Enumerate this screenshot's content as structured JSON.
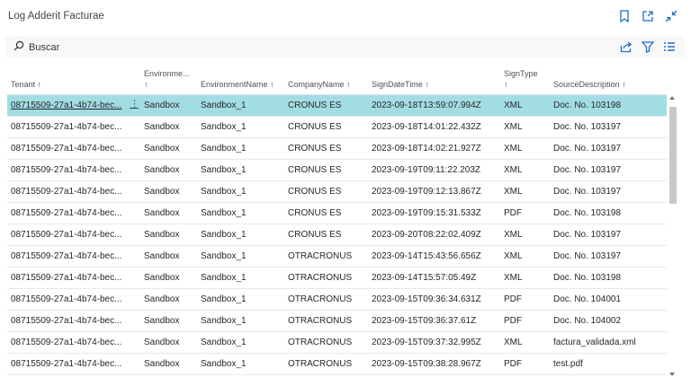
{
  "window": {
    "title": "Log Adderit Facturae",
    "icons": [
      "bookmark-icon",
      "open-new-window-icon",
      "collapse-icon"
    ]
  },
  "toolbar": {
    "search_label": "Buscar",
    "icons": [
      "share-icon",
      "filter-icon",
      "list-view-icon"
    ]
  },
  "columns": [
    {
      "label": "Tenant",
      "sort": "↑"
    },
    {
      "label": "Environme...",
      "sort": "↑"
    },
    {
      "label": "EnvironmentName",
      "sort": "↑"
    },
    {
      "label": "CompanyName",
      "sort": "↑"
    },
    {
      "label": "SignDateTime",
      "sort": "↑"
    },
    {
      "label": "SignType",
      "sort": "↑"
    },
    {
      "label": "SourceDescription",
      "sort": "↑"
    }
  ],
  "rows": [
    [
      "08715509-27a1-4b74-bec...",
      "Sandbox",
      "Sandbox_1",
      "CRONUS ES",
      "2023-09-18T13:59:07.994Z",
      "XML",
      "Doc. No. 103198"
    ],
    [
      "08715509-27a1-4b74-bec...",
      "Sandbox",
      "Sandbox_1",
      "CRONUS ES",
      "2023-09-18T14:01:22.432Z",
      "XML",
      "Doc. No. 103197"
    ],
    [
      "08715509-27a1-4b74-bec...",
      "Sandbox",
      "Sandbox_1",
      "CRONUS ES",
      "2023-09-18T14:02:21.927Z",
      "XML",
      "Doc. No. 103197"
    ],
    [
      "08715509-27a1-4b74-bec...",
      "Sandbox",
      "Sandbox_1",
      "CRONUS ES",
      "2023-09-19T09:11:22.203Z",
      "XML",
      "Doc. No. 103197"
    ],
    [
      "08715509-27a1-4b74-bec...",
      "Sandbox",
      "Sandbox_1",
      "CRONUS ES",
      "2023-09-19T09:12:13.867Z",
      "XML",
      "Doc. No. 103197"
    ],
    [
      "08715509-27a1-4b74-bec...",
      "Sandbox",
      "Sandbox_1",
      "CRONUS ES",
      "2023-09-19T09:15:31.533Z",
      "PDF",
      "Doc. No. 103198"
    ],
    [
      "08715509-27a1-4b74-bec...",
      "Sandbox",
      "Sandbox_1",
      "CRONUS ES",
      "2023-09-20T08:22:02.409Z",
      "XML",
      "Doc. No. 103197"
    ],
    [
      "08715509-27a1-4b74-bec...",
      "Sandbox",
      "Sandbox_1",
      "OTRACRONUS",
      "2023-09-14T15:43:56.656Z",
      "XML",
      "Doc. No. 103197"
    ],
    [
      "08715509-27a1-4b74-bec...",
      "Sandbox",
      "Sandbox_1",
      "OTRACRONUS",
      "2023-09-14T15:57:05.49Z",
      "XML",
      "Doc. No. 103198"
    ],
    [
      "08715509-27a1-4b74-bec...",
      "Sandbox",
      "Sandbox_1",
      "OTRACRONUS",
      "2023-09-15T09:36:34.631Z",
      "PDF",
      "Doc. No. 104001"
    ],
    [
      "08715509-27a1-4b74-bec...",
      "Sandbox",
      "Sandbox_1",
      "OTRACRONUS",
      "2023-09-15T09:36:37.61Z",
      "PDF",
      "Doc. No. 104002"
    ],
    [
      "08715509-27a1-4b74-bec...",
      "Sandbox",
      "Sandbox_1",
      "OTRACRONUS",
      "2023-09-15T09:37:32.995Z",
      "XML",
      "factura_validada.xml"
    ],
    [
      "08715509-27a1-4b74-bec...",
      "Sandbox",
      "Sandbox_1",
      "OTRACRONUS",
      "2023-09-15T09:38:28.967Z",
      "PDF",
      "test.pdf"
    ]
  ],
  "selected_row": 0,
  "row_menu_glyph": "⋮",
  "colors": {
    "selected_row": "#a3dde4",
    "accent_icon": "#1c6fc6"
  }
}
